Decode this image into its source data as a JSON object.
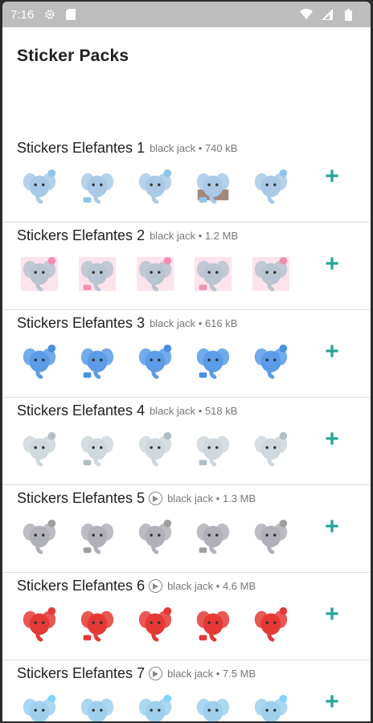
{
  "status_bar": {
    "time": "7:16",
    "icons": [
      "gear-icon",
      "sd-card-icon",
      "wifi-icon",
      "signal-icon",
      "battery-icon"
    ]
  },
  "page_title": "Sticker Packs",
  "add_label": "+",
  "packs": [
    {
      "name": "Stickers Elefantes 1",
      "publisher": "black jack",
      "size": "740 kB",
      "animated": false,
      "theme": "cute",
      "accent": "#8ec5e8"
    },
    {
      "name": "Stickers Elefantes 2",
      "publisher": "black jack",
      "size": "1.2 MB",
      "animated": false,
      "theme": "pink",
      "accent": "#f48fb1"
    },
    {
      "name": "Stickers Elefantes 3",
      "publisher": "black jack",
      "size": "616 kB",
      "animated": false,
      "theme": "blue",
      "accent": "#4a90e2"
    },
    {
      "name": "Stickers Elefantes 4",
      "publisher": "black jack",
      "size": "518 kB",
      "animated": false,
      "theme": "sketch",
      "accent": "#b0bec5"
    },
    {
      "name": "Stickers Elefantes 5",
      "publisher": "black jack",
      "size": "1.3 MB",
      "animated": true,
      "theme": "gray",
      "accent": "#9e9e9e"
    },
    {
      "name": "Stickers Elefantes 6",
      "publisher": "black jack",
      "size": "4.6 MB",
      "animated": true,
      "theme": "red",
      "accent": "#e53935"
    },
    {
      "name": "Stickers Elefantes 7",
      "publisher": "black jack",
      "size": "7.5 MB",
      "animated": true,
      "theme": "lightblue",
      "accent": "#81d4fa"
    }
  ]
}
